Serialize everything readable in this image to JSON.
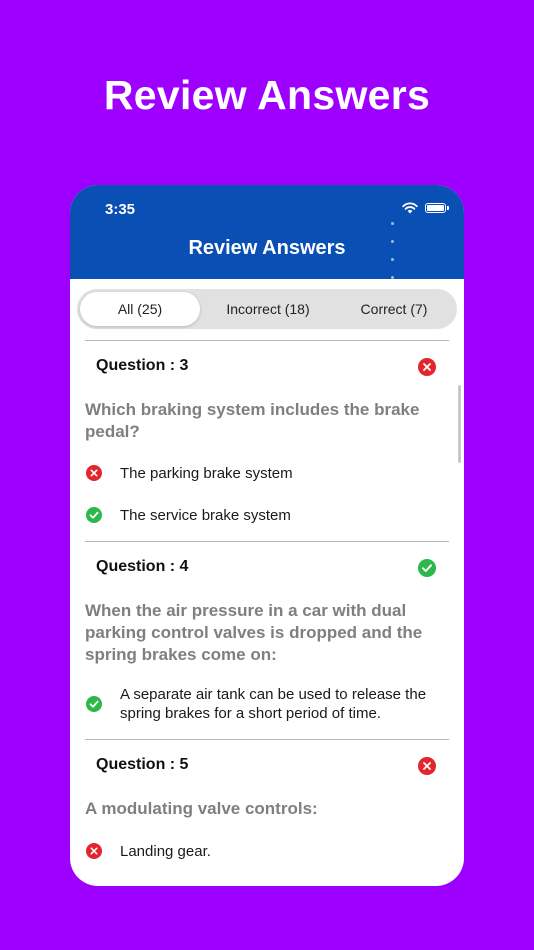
{
  "promo": {
    "title": "Review Answers"
  },
  "status_bar": {
    "time": "3:35"
  },
  "header": {
    "title": "Review Answers"
  },
  "colors": {
    "background": "#9d00ff",
    "header": "#0a4fb3",
    "correct": "#2db84b",
    "incorrect": "#e1272d"
  },
  "filters": [
    {
      "label": "All (25)",
      "selected": true
    },
    {
      "label": "Incorrect (18)",
      "selected": false
    },
    {
      "label": "Correct (7)",
      "selected": false
    }
  ],
  "questions": [
    {
      "label": "Question : 3",
      "result": "incorrect",
      "text": "Which braking system includes the brake pedal?",
      "options": [
        {
          "text": "The parking brake system",
          "status": "incorrect"
        },
        {
          "text": "The service brake system",
          "status": "correct"
        }
      ]
    },
    {
      "label": "Question : 4",
      "result": "correct",
      "text": "When the air pressure in a car with dual parking control valves is dropped and the spring brakes come on:",
      "options": [
        {
          "text": "A separate air tank can be used to release the spring brakes for a short period of time.",
          "status": "correct"
        }
      ]
    },
    {
      "label": "Question : 5",
      "result": "incorrect",
      "text": "A modulating valve controls:",
      "options": [
        {
          "text": "Landing gear.",
          "status": "incorrect"
        }
      ]
    }
  ]
}
